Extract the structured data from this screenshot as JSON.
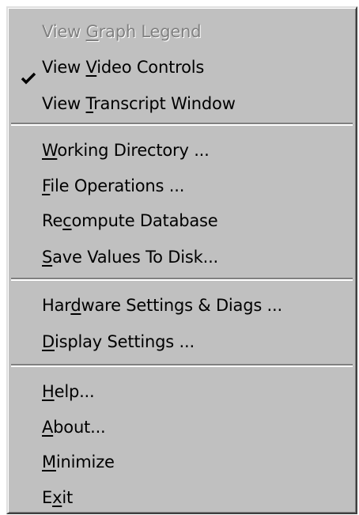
{
  "menu": {
    "items": [
      {
        "pre": "View ",
        "key": "G",
        "post": "raph Legend",
        "disabled": true,
        "checked": false
      },
      {
        "pre": "View ",
        "key": "V",
        "post": "ideo Controls",
        "disabled": false,
        "checked": true
      },
      {
        "pre": "View ",
        "key": "T",
        "post": "ranscript Window",
        "disabled": false,
        "checked": false
      },
      {
        "pre": "",
        "key": "W",
        "post": "orking Directory ...",
        "disabled": false,
        "checked": false
      },
      {
        "pre": "",
        "key": "F",
        "post": "ile Operations ...",
        "disabled": false,
        "checked": false
      },
      {
        "pre": "Re",
        "key": "c",
        "post": "ompute Database",
        "disabled": false,
        "checked": false
      },
      {
        "pre": "",
        "key": "S",
        "post": "ave Values To Disk...",
        "disabled": false,
        "checked": false
      },
      {
        "pre": "Har",
        "key": "d",
        "post": "ware Settings & Diags ...",
        "disabled": false,
        "checked": false
      },
      {
        "pre": "",
        "key": "D",
        "post": "isplay Settings ...",
        "disabled": false,
        "checked": false
      },
      {
        "pre": "",
        "key": "H",
        "post": "elp...",
        "disabled": false,
        "checked": false
      },
      {
        "pre": "",
        "key": "A",
        "post": "bout...",
        "disabled": false,
        "checked": false
      },
      {
        "pre": "",
        "key": "M",
        "post": "inimize",
        "disabled": false,
        "checked": false
      },
      {
        "pre": "E",
        "key": "x",
        "post": "it",
        "disabled": false,
        "checked": false
      }
    ],
    "check_icon": "check-mark-icon",
    "colors": {
      "face": "#c0c0c0",
      "text": "#000000",
      "disabled_text": "#808080",
      "highlight": "#ffffff",
      "shadow": "#808080"
    }
  }
}
